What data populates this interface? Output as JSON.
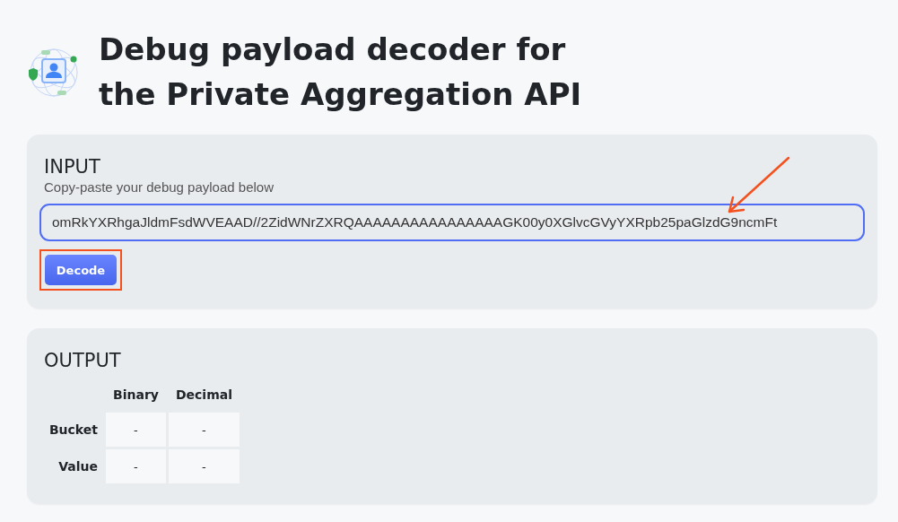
{
  "title": "Debug payload decoder for the Private Aggregation API",
  "input": {
    "heading": "INPUT",
    "hint": "Copy-paste your debug payload below",
    "value": "omRkYXRhgaJldmFsdWVEAAD//2ZidWNrZXRQAAAAAAAAAAAAAAAAGK00y0XGlvcGVyYXRpb25paGlzdG9ncmFt",
    "button": "Decode",
    "button_highlighted": true,
    "arrow": true
  },
  "output": {
    "heading": "OUTPUT",
    "columns": [
      "Binary",
      "Decimal"
    ],
    "rows": [
      {
        "label": "Bucket",
        "cells": [
          "-",
          "-"
        ]
      },
      {
        "label": "Value",
        "cells": [
          "-",
          "-"
        ]
      }
    ]
  }
}
